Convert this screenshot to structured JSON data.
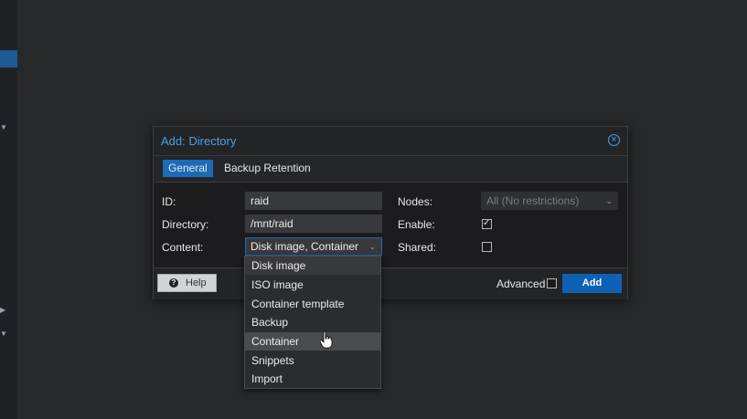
{
  "dialog": {
    "title": "Add: Directory",
    "tabs": [
      {
        "label": "General",
        "active": true
      },
      {
        "label": "Backup Retention",
        "active": false
      }
    ]
  },
  "form": {
    "id_label": "ID:",
    "id_value": "raid",
    "directory_label": "Directory:",
    "directory_value": "/mnt/raid",
    "content_label": "Content:",
    "content_value": "Disk image, Container",
    "nodes_label": "Nodes:",
    "nodes_value": "All (No restrictions)",
    "enable_label": "Enable:",
    "enable_checked": true,
    "shared_label": "Shared:",
    "shared_checked": false
  },
  "footer": {
    "help_label": "Help",
    "advanced_label": "Advanced",
    "advanced_checked": false,
    "add_label": "Add"
  },
  "content_dropdown": {
    "options": [
      "Disk image",
      "ISO image",
      "Container template",
      "Backup",
      "Container",
      "Snippets",
      "Import"
    ],
    "selected": [
      "Disk image",
      "Container"
    ],
    "hovered": "Container"
  },
  "icons": {
    "close": "close-circle-icon",
    "help": "question-circle-icon",
    "checkbox_mark": "check-icon",
    "chevron": "chevron-down-icon",
    "cursor": "hand-pointer-icon"
  },
  "colors": {
    "accent": "#1b6bb8",
    "title": "#49a1e8",
    "background": "#27282b",
    "dialog_bg": "#1c1c1e",
    "primary_button": "#0d62b5"
  }
}
